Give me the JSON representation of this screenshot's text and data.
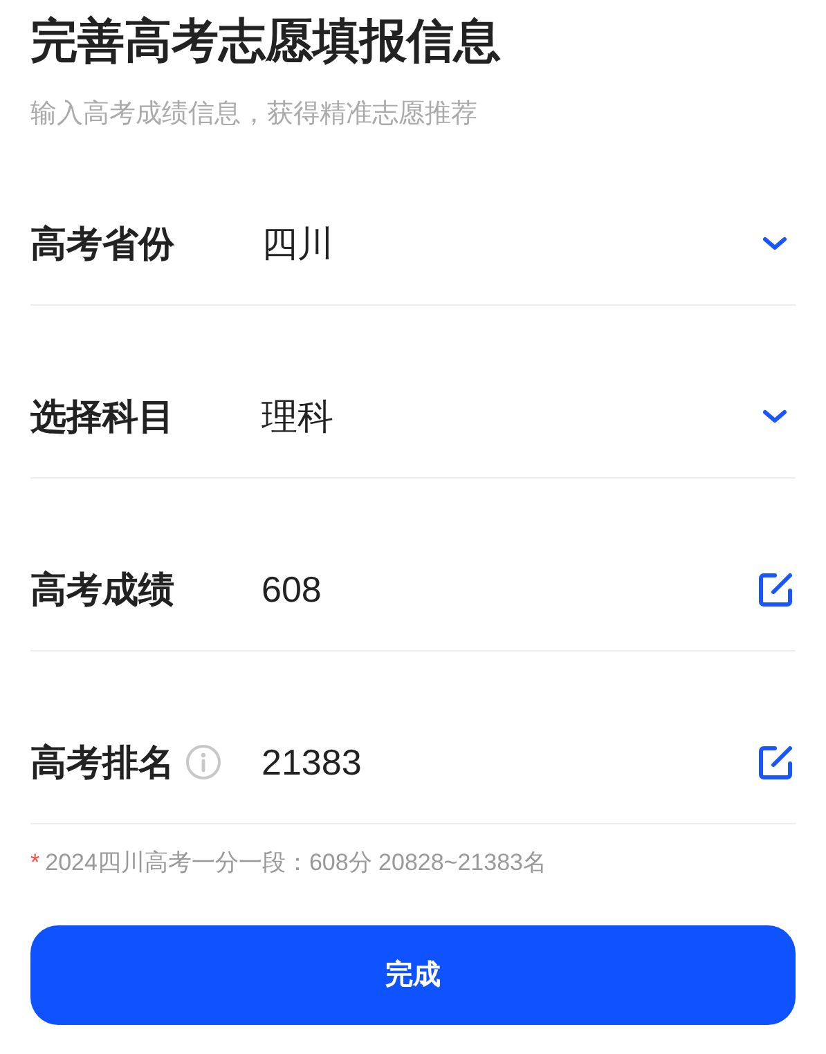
{
  "title": "完善高考志愿填报信息",
  "subtitle": "输入高考成绩信息，获得精准志愿推荐",
  "rows": [
    {
      "kind": "select",
      "label": "高考省份",
      "value": "四川",
      "info": false
    },
    {
      "kind": "select",
      "label": "选择科目",
      "value": "理科",
      "info": false
    },
    {
      "kind": "input",
      "label": "高考成绩",
      "value": "608",
      "info": false
    },
    {
      "kind": "input",
      "label": "高考排名",
      "value": "21383",
      "info": true
    }
  ],
  "note": {
    "mark": "*",
    "text": "2024四川高考一分一段：608分 20828~21383名"
  },
  "button": "完成"
}
